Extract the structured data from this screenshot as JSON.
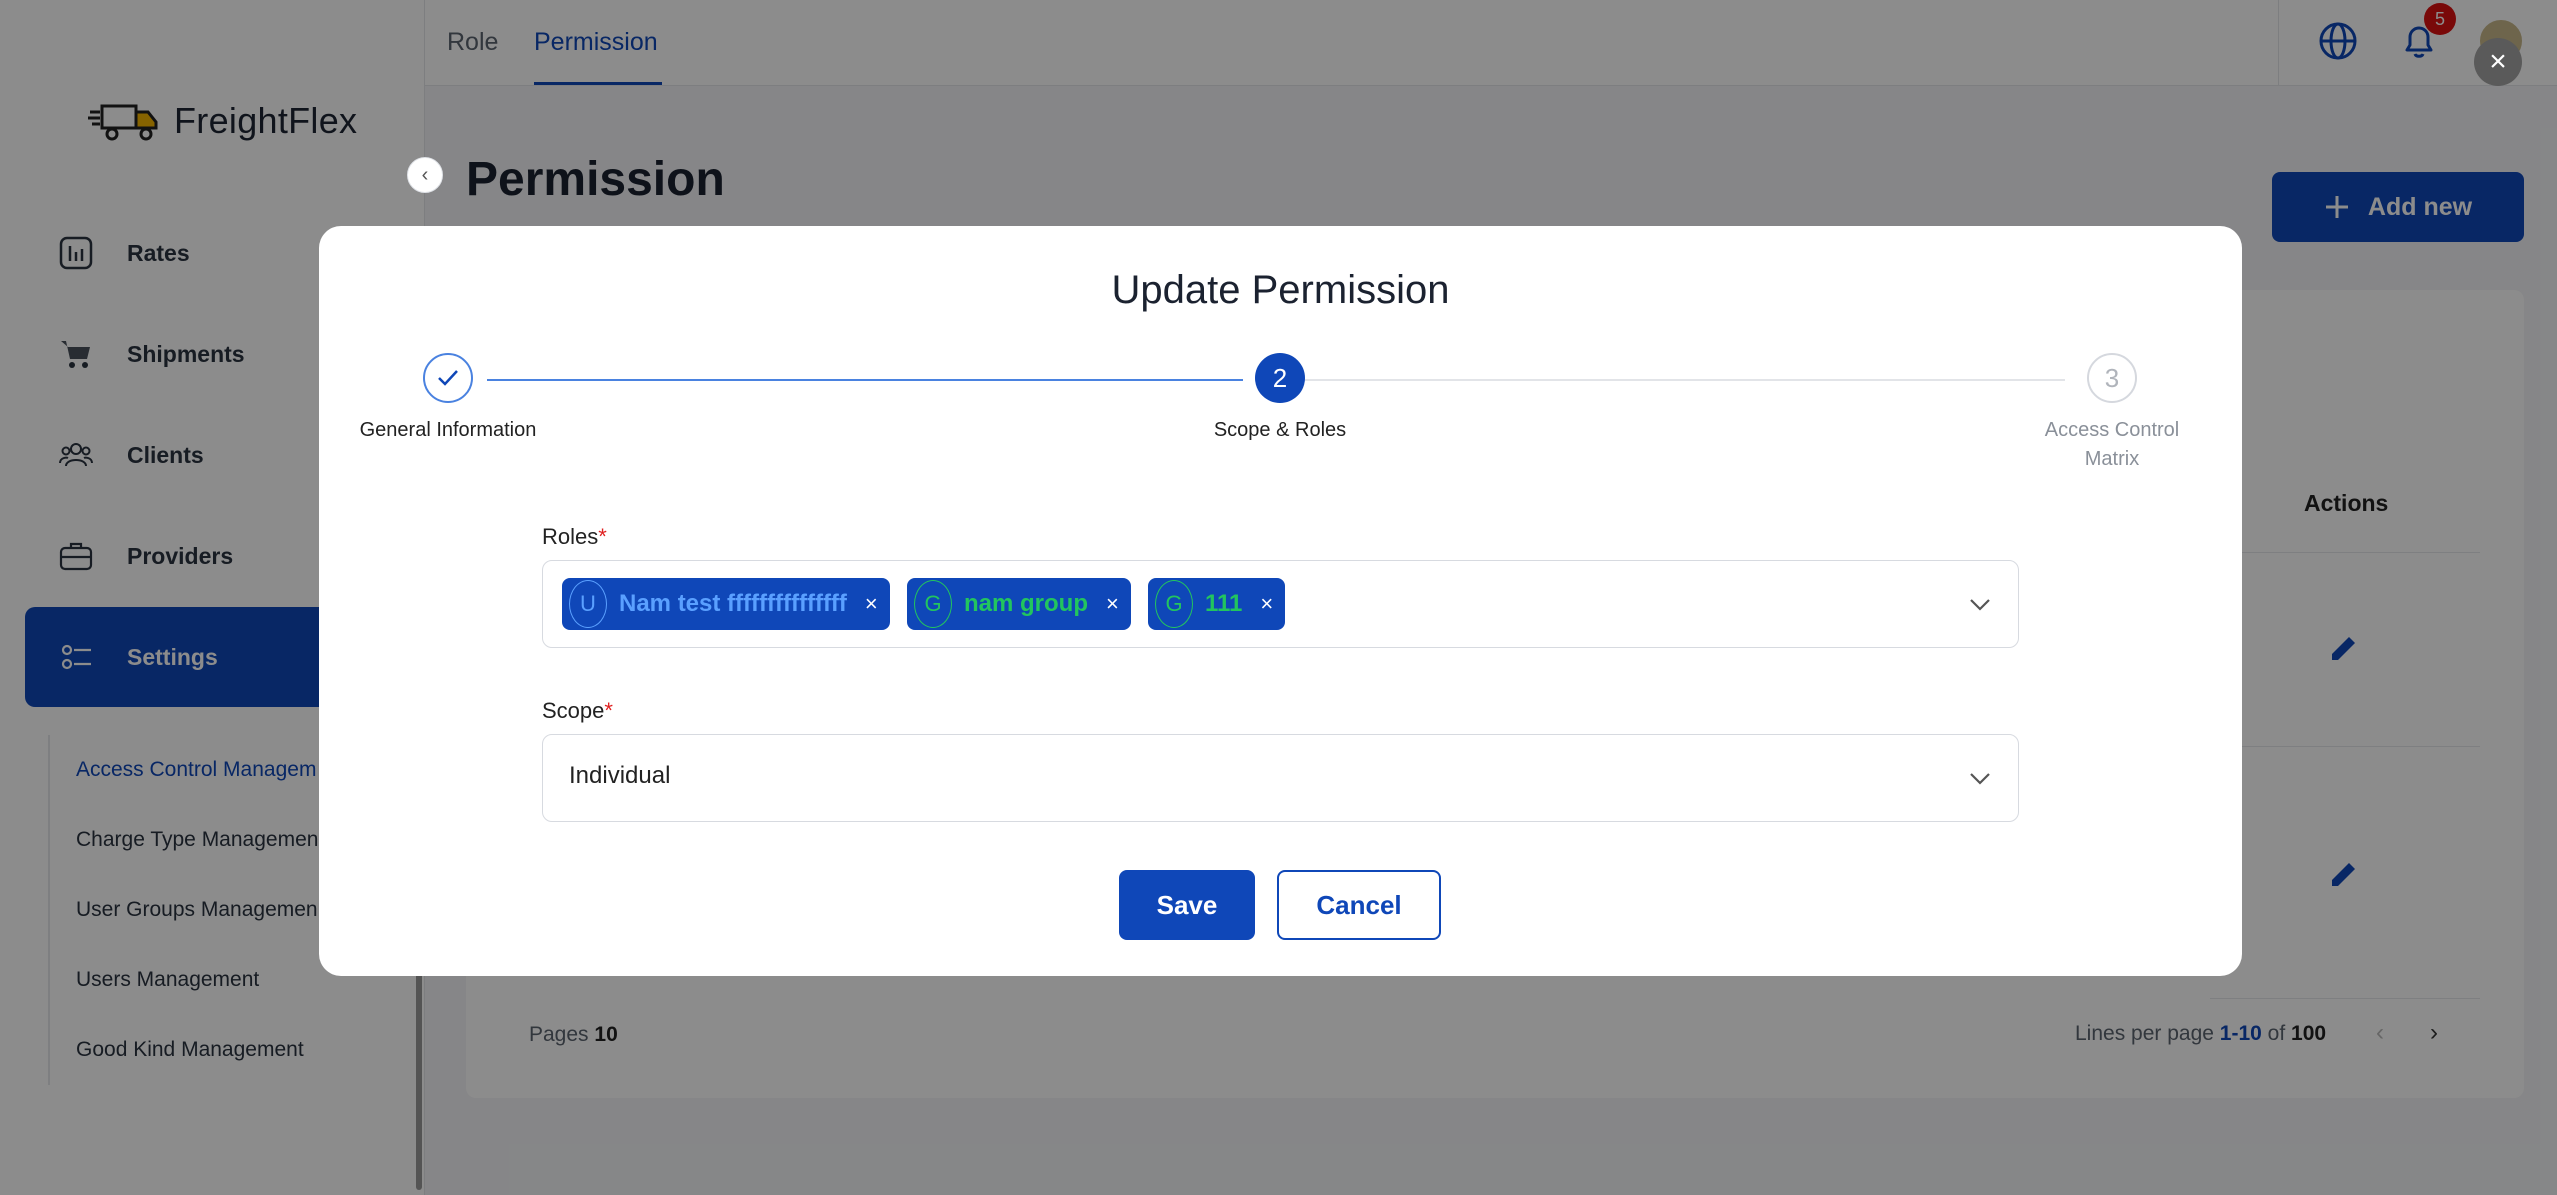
{
  "app": {
    "name": "FreightFlex"
  },
  "topbar": {
    "tabs": [
      {
        "label": "Role"
      },
      {
        "label": "Permission"
      }
    ],
    "notification_count": "5"
  },
  "sidebar": {
    "items": [
      {
        "label": "Rates",
        "icon": "chart-icon"
      },
      {
        "label": "Shipments",
        "icon": "cart-icon"
      },
      {
        "label": "Clients",
        "icon": "users-icon"
      },
      {
        "label": "Providers",
        "icon": "briefcase-icon"
      },
      {
        "label": "Settings",
        "icon": "settings-icon"
      }
    ],
    "sub_items": [
      {
        "label": "Access Control Managem"
      },
      {
        "label": "Charge Type Managemen"
      },
      {
        "label": "User Groups Managemen"
      },
      {
        "label": "Users Management"
      },
      {
        "label": "Good Kind Management"
      }
    ]
  },
  "page": {
    "title": "Permission",
    "add_button": "Add new",
    "actions_header": "Actions",
    "footer": {
      "pages_label": "Pages",
      "pages_value": "10",
      "lines_label": "Lines per page",
      "range": "1-10",
      "of_label": "of",
      "total": "100"
    }
  },
  "modal": {
    "title": "Update Permission",
    "steps": [
      {
        "label": "General Information",
        "status": "done",
        "number": "1"
      },
      {
        "label": "Scope & Roles",
        "status": "active",
        "number": "2"
      },
      {
        "label": "Access Control Matrix",
        "label_line1": "Access Control",
        "label_line2": "Matrix",
        "status": "pending",
        "number": "3"
      }
    ],
    "roles_label": "Roles",
    "required_mark": "*",
    "roles": [
      {
        "letter": "U",
        "name": "Nam test fffffffffffffff",
        "color": "#5aa0ff"
      },
      {
        "letter": "G",
        "name": "nam group",
        "color": "#22c55e"
      },
      {
        "letter": "G",
        "name": "111",
        "color": "#22c55e"
      }
    ],
    "scope_label": "Scope",
    "scope_value": "Individual",
    "save_label": "Save",
    "cancel_label": "Cancel"
  },
  "colors": {
    "primary": "#0f47b8",
    "required": "#e02020",
    "badge": "#dd1111"
  }
}
